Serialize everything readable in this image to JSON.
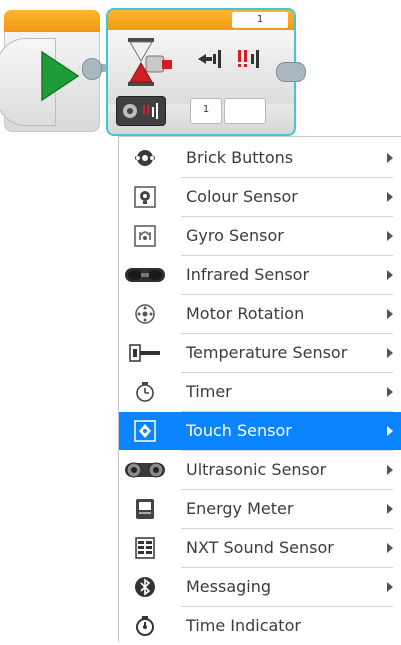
{
  "program": {
    "wait_block": {
      "threshold_value": "1",
      "port_value": "1"
    }
  },
  "menu": {
    "items": [
      {
        "label": "Brick Buttons",
        "icon": "brick-buttons-icon",
        "has_submenu": true
      },
      {
        "label": "Colour Sensor",
        "icon": "colour-sensor-icon",
        "has_submenu": true
      },
      {
        "label": "Gyro Sensor",
        "icon": "gyro-sensor-icon",
        "has_submenu": true
      },
      {
        "label": "Infrared Sensor",
        "icon": "infrared-sensor-icon",
        "has_submenu": true
      },
      {
        "label": "Motor Rotation",
        "icon": "motor-rotation-icon",
        "has_submenu": true
      },
      {
        "label": "Temperature Sensor",
        "icon": "temperature-sensor-icon",
        "has_submenu": true
      },
      {
        "label": "Timer",
        "icon": "timer-icon",
        "has_submenu": true
      },
      {
        "label": "Touch Sensor",
        "icon": "touch-sensor-icon",
        "has_submenu": true,
        "selected": true
      },
      {
        "label": "Ultrasonic Sensor",
        "icon": "ultrasonic-sensor-icon",
        "has_submenu": true
      },
      {
        "label": "Energy Meter",
        "icon": "energy-meter-icon",
        "has_submenu": true
      },
      {
        "label": "NXT Sound Sensor",
        "icon": "nxt-sound-sensor-icon",
        "has_submenu": true
      },
      {
        "label": "Messaging",
        "icon": "messaging-icon",
        "has_submenu": true
      },
      {
        "label": "Time Indicator",
        "icon": "time-indicator-icon",
        "has_submenu": false
      }
    ]
  },
  "colors": {
    "selection": "#0a84ff",
    "block_header": "#f5a623",
    "selected_outline": "#46c3d4",
    "start_play": "#1f9c3a",
    "hourglass_red": "#d21f26"
  }
}
